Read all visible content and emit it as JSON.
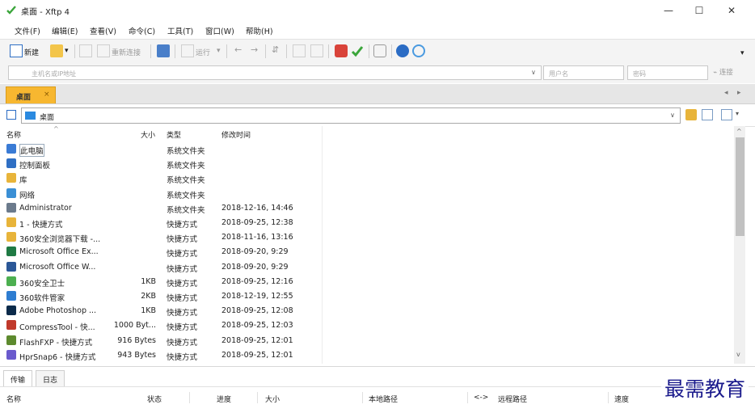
{
  "window": {
    "title": "桌面 - Xftp 4",
    "minimize": "—",
    "maximize": "☐",
    "close": "✕"
  },
  "menu": [
    "文件(F)",
    "编辑(E)",
    "查看(V)",
    "命令(C)",
    "工具(T)",
    "窗口(W)",
    "帮助(H)"
  ],
  "toolbar": {
    "new_label": "新建",
    "reconnect_label": "重新连接",
    "run_label": "运行"
  },
  "address": {
    "host_placeholder": "主机名或IP地址",
    "user_placeholder": "用户名",
    "password_placeholder": "密码",
    "connect_label": "连接"
  },
  "tab": {
    "label": "桌面",
    "close": "×",
    "prev": "◂",
    "next": "▸"
  },
  "path": {
    "value": "桌面"
  },
  "columns": {
    "name": "名称",
    "size": "大小",
    "type": "类型",
    "modified": "修改时间"
  },
  "files": [
    {
      "name": "此电脑",
      "size": "",
      "type": "系统文件夹",
      "modified": "",
      "icon": "computer-icon",
      "color": "#3a7bd5"
    },
    {
      "name": "控制面板",
      "size": "",
      "type": "系统文件夹",
      "modified": "",
      "icon": "control-panel-icon",
      "color": "#2f6fc4"
    },
    {
      "name": "库",
      "size": "",
      "type": "系统文件夹",
      "modified": "",
      "icon": "library-icon",
      "color": "#e8b43a"
    },
    {
      "name": "网络",
      "size": "",
      "type": "系统文件夹",
      "modified": "",
      "icon": "network-icon",
      "color": "#3a8fd5"
    },
    {
      "name": "Administrator",
      "size": "",
      "type": "系统文件夹",
      "modified": "2018-12-16, 14:46",
      "icon": "user-folder-icon",
      "color": "#6b7a8c"
    },
    {
      "name": "1 - 快捷方式",
      "size": "",
      "type": "快捷方式",
      "modified": "2018-09-25, 12:38",
      "icon": "shortcut-icon",
      "color": "#e8b43a"
    },
    {
      "name": "360安全浏览器下载 -...",
      "size": "",
      "type": "快捷方式",
      "modified": "2018-11-16, 13:16",
      "icon": "shortcut-icon",
      "color": "#e8b43a"
    },
    {
      "name": "Microsoft Office Ex...",
      "size": "",
      "type": "快捷方式",
      "modified": "2018-09-20, 9:29",
      "icon": "excel-icon",
      "color": "#1f7a44"
    },
    {
      "name": "Microsoft Office W...",
      "size": "",
      "type": "快捷方式",
      "modified": "2018-09-20, 9:29",
      "icon": "word-icon",
      "color": "#2b5797"
    },
    {
      "name": "360安全卫士",
      "size": "1KB",
      "type": "快捷方式",
      "modified": "2018-09-25, 12:16",
      "icon": "security-icon",
      "color": "#4caf50"
    },
    {
      "name": "360软件管家",
      "size": "2KB",
      "type": "快捷方式",
      "modified": "2018-12-19, 12:55",
      "icon": "software-manager-icon",
      "color": "#2e7dd1"
    },
    {
      "name": "Adobe Photoshop ...",
      "size": "1KB",
      "type": "快捷方式",
      "modified": "2018-09-25, 12:08",
      "icon": "photoshop-icon",
      "color": "#0b2a4a"
    },
    {
      "name": "CompressTool - 快...",
      "size": "1000 Byt...",
      "type": "快捷方式",
      "modified": "2018-09-25, 12:03",
      "icon": "compress-icon",
      "color": "#c0392b"
    },
    {
      "name": "FlashFXP - 快捷方式",
      "size": "916 Bytes",
      "type": "快捷方式",
      "modified": "2018-09-25, 12:01",
      "icon": "flashfxp-icon",
      "color": "#5d8a2e"
    },
    {
      "name": "HprSnap6 - 快捷方式",
      "size": "943 Bytes",
      "type": "快捷方式",
      "modified": "2018-09-25, 12:01",
      "icon": "hypersnap-icon",
      "color": "#6a5acd"
    }
  ],
  "bottom_tabs": [
    "传输",
    "日志"
  ],
  "transfer_columns": {
    "name": "名称",
    "status": "状态",
    "progress": "进度",
    "size": "大小",
    "local_path": "本地路径",
    "arrow": "<->",
    "remote_path": "远程路径",
    "speed": "速度"
  },
  "watermark": "最需教育"
}
